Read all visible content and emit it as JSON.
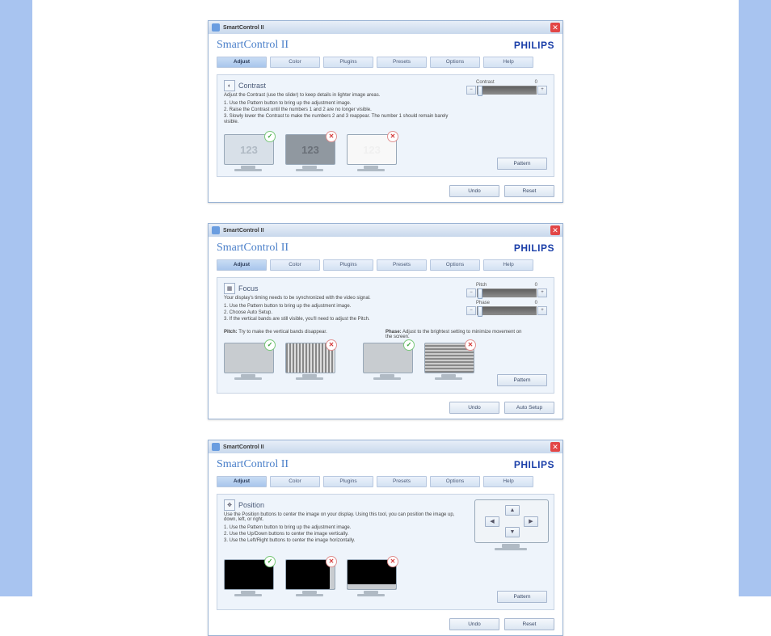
{
  "window_title": "SmartControl II",
  "app_title": "SmartControl II",
  "brand": "PHILIPS",
  "tabs": [
    "Adjust",
    "Color",
    "Plugins",
    "Presets",
    "Options",
    "Help"
  ],
  "footer": {
    "undo": "Undo",
    "reset": "Reset",
    "auto": "Auto Setup"
  },
  "pattern_btn": "Pattern",
  "win1": {
    "section_title": "Contrast",
    "desc": "Adjust the Contrast (use the slider) to keep details in lighter image areas.",
    "step1": "1. Use the Pattern button to bring up the adjustment image.",
    "step2": "2. Raise the Contrast until the numbers 1 and 2 are no longer visible.",
    "step3": "3. Slowly lower the Contrast to make the numbers 2 and 3 reappear. The number 1 should remain barely visible.",
    "slider_label": "Contrast",
    "slider_value": "0"
  },
  "win2": {
    "section_title": "Focus",
    "desc": "Your display's timing needs to be synchronized with the video signal.",
    "step1": "1. Use the Pattern button to bring up the adjustment image.",
    "step2": "2. Choose Auto Setup.",
    "step3": "3. If the vertical bands are still visible, you'll need to adjust the Pitch.",
    "pitch_hint": "Pitch: Try to make the vertical bands disappear.",
    "phase_hint": "Phase: Adjust to the brightest setting to minimize movement on the screen.",
    "slider1_label": "Pitch",
    "slider1_value": "0",
    "slider2_label": "Phase",
    "slider2_value": "0"
  },
  "win3": {
    "section_title": "Position",
    "desc": "Use the Position buttons to center the image on your display. Using this tool, you can position the image up, down, left, or right.",
    "step1": "1. Use the Pattern button to bring up the adjustment image.",
    "step2": "2. Use the Up/Down buttons to center the image vertically.",
    "step3": "3. Use the Left/Right buttons to center the image horizontally."
  }
}
